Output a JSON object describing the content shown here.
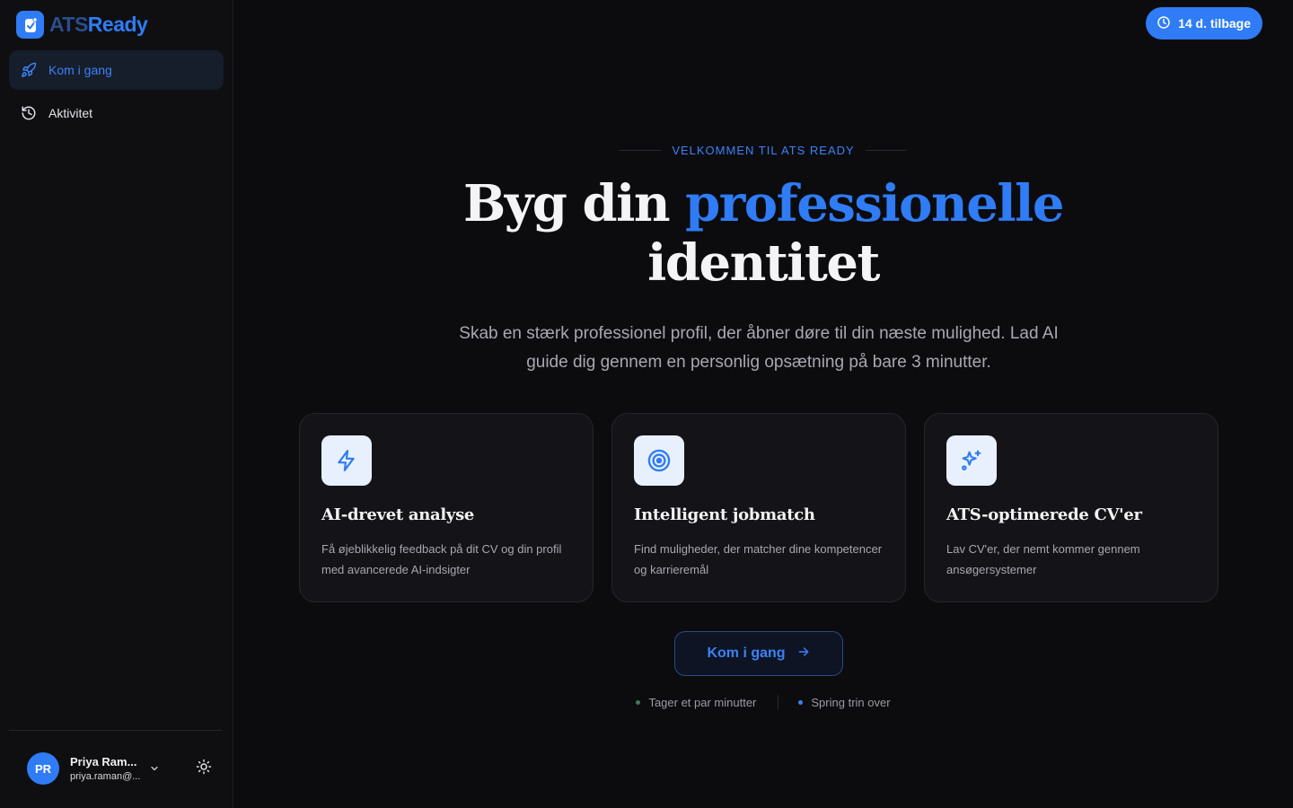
{
  "app": {
    "logo_ats": "ATS",
    "logo_ready": "Ready"
  },
  "sidebar": {
    "items": [
      {
        "label": "Kom i gang",
        "icon": "rocket-icon",
        "active": true
      },
      {
        "label": "Aktivitet",
        "icon": "history-icon",
        "active": false
      }
    ]
  },
  "user": {
    "initials": "PR",
    "name": "Priya Ram...",
    "email": "priya.raman@..."
  },
  "trial": {
    "label": "14 d. tilbage"
  },
  "hero": {
    "eyebrow": "VELKOMMEN TIL ATS READY",
    "title_before": "Byg din ",
    "title_accent": "professionelle",
    "title_after": "identitet",
    "subtitle": "Skab en stærk professionel profil, der åbner døre til din næste mulighed. Lad AI guide dig gennem en personlig opsætning på bare 3 minutter."
  },
  "cards": [
    {
      "title": "AI-drevet analyse",
      "desc": "Få øjeblikkelig feedback på dit CV og din profil med avancerede AI-indsigter",
      "icon": "lightning-icon"
    },
    {
      "title": "Intelligent jobmatch",
      "desc": "Find muligheder, der matcher dine kompetencer og karrieremål",
      "icon": "target-icon"
    },
    {
      "title": "ATS-optimerede CV'er",
      "desc": "Lav CV'er, der nemt kommer gennem ansøgersystemer",
      "icon": "sparkles-icon"
    }
  ],
  "cta": {
    "label": "Kom i gang"
  },
  "meta": {
    "time": "Tager et par minutter",
    "skip": "Spring trin over"
  },
  "colors": {
    "accent": "#2f7cf6",
    "background": "#0c0c0f",
    "dot_time": "#3d7a5c",
    "dot_skip": "#3b82f6"
  }
}
